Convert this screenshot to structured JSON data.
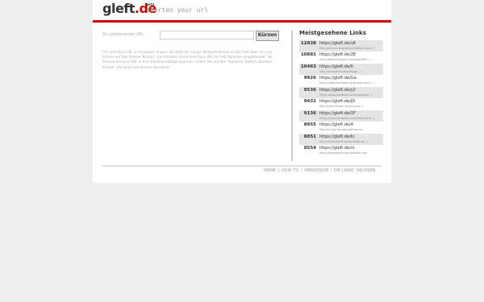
{
  "header": {
    "logo_main": "gleft",
    "logo_dot": ".de",
    "beta": "beta",
    "tagline": "shorten your url"
  },
  "form": {
    "label": "Zu verkürzende URL:",
    "input_value": "",
    "submit_label": "Kürzen",
    "help_text": "Um eine Kurz-URL zu erzeugen, tragen Sie bitte die 'lange' Webseitadresse in das Feld oben ein und klicken auf den Button 'Kürzen'. Sie erhalten damit eine Kurz-URL im Feld darunter eingeblendet. Sie können die Kurz-URL in Ihre Zwischenablage kopieren, indem Sie auf den 'Kopieren' Button daneben klicken. (Ab Quad mit diesem Shortener"
  },
  "sidebar": {
    "title": "Meistgesehene Links",
    "links": [
      {
        "count": "12838",
        "short": "https://gleft.de/uK",
        "long": "http://pop-vnt.wla/pde/buckqi?ap=rget...)"
      },
      {
        "count": "10881",
        "short": "https://gleft.de/2E",
        "long": "http://www.facebook.com/pages/ER-(...)"
      },
      {
        "count": "10463",
        "short": "https://gleft.de/lt",
        "long": "http://inlshfuhrer.de/anfinge/...)"
      },
      {
        "count": "9926",
        "short": "https://gleft.de/Ga",
        "long": "https://www.facebook.com/notes.php?(...)"
      },
      {
        "count": "9536",
        "short": "https://gleft.de/y2",
        "long": "https://www.facebook.com/linkspamt...)"
      },
      {
        "count": "9431",
        "short": "https://gleft.de/jO",
        "long": "http://linkshfuhrer.de/im-wand...)"
      },
      {
        "count": "9136",
        "short": "https://gleft.de/1F",
        "long": "https://www.facebook.com/bodo.ramel...)"
      },
      {
        "count": "8955",
        "short": "https://gleft.de/4",
        "long": "http://m.daimke-wannachsen.de"
      },
      {
        "count": "8851",
        "short": "https://gleft.de/ki",
        "long": "http://linkshfuhrer.de/im-wertpunt...)"
      },
      {
        "count": "8554",
        "short": "https://gleft.de/m",
        "long": "http://roseegoonthink.blogspot.com"
      }
    ]
  },
  "footer": {
    "items": [
      "HOME",
      "HOW TO",
      "IMPRESSUM",
      "DIE LINKE. SACHSEN"
    ],
    "separator": "|"
  }
}
